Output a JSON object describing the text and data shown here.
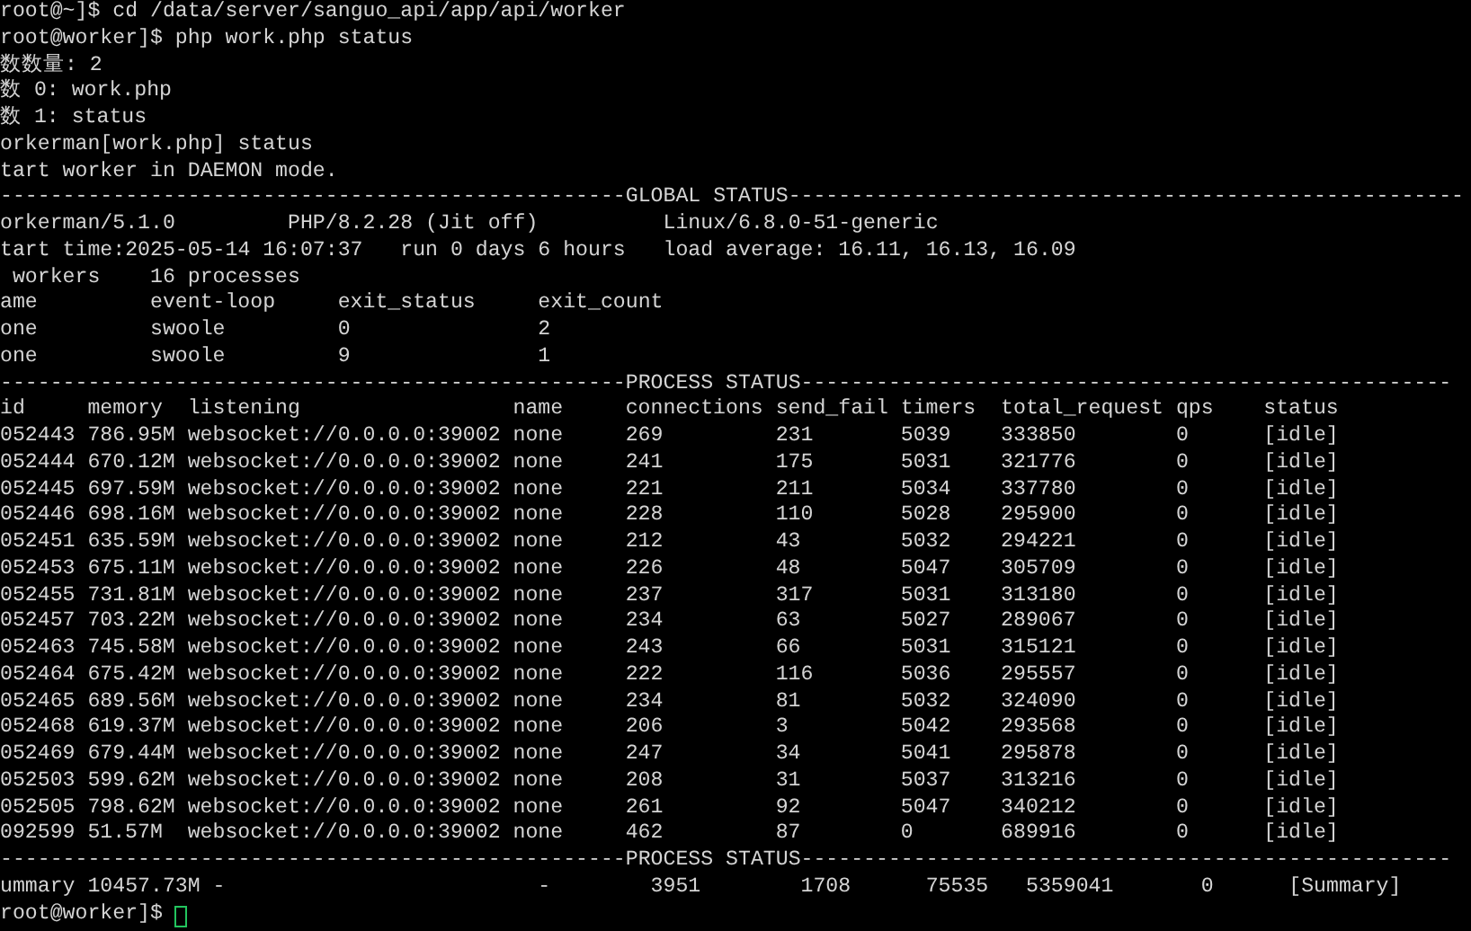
{
  "lines": [
    {
      "kind": "prompt",
      "prompt": "root@~]$",
      "command": "cd /data/server/sanguo_api/app/api/worker"
    },
    {
      "kind": "prompt",
      "prompt": "root@worker]$",
      "command": "php work.php status"
    },
    {
      "kind": "text",
      "text": "数数量: 2"
    },
    {
      "kind": "text",
      "text": "数 0: work.php"
    },
    {
      "kind": "text",
      "text": "数 1: status"
    },
    {
      "kind": "text",
      "text": "orkerman[work.php] status"
    },
    {
      "kind": "text",
      "text": "tart worker in DAEMON mode."
    },
    {
      "kind": "separator",
      "text": "--------------------------------------------------GLOBAL STATUS------------------------------------------------------"
    },
    {
      "kind": "text",
      "text": "orkerman/5.1.0         PHP/8.2.28 (Jit off)          Linux/6.8.0-51-generic"
    },
    {
      "kind": "text",
      "text": "tart time:2025-05-14 16:07:37   run 0 days 6 hours   load average: 16.11, 16.13, 16.09"
    },
    {
      "kind": "text",
      "text": " workers    16 processes"
    },
    {
      "kind": "table",
      "columns": [
        "ame",
        "event-loop",
        "exit_status",
        "exit_count"
      ],
      "rows": [
        [
          "one",
          "swoole",
          "0",
          "2"
        ],
        [
          "one",
          "swoole",
          "9",
          "1"
        ]
      ]
    },
    {
      "kind": "separator",
      "text": "--------------------------------------------------PROCESS STATUS----------------------------------------------------"
    },
    {
      "kind": "table",
      "columns": [
        "id",
        "memory",
        "listening",
        "name",
        "connections",
        "send_fail",
        "timers",
        "total_request",
        "qps",
        "status"
      ],
      "rows": [
        [
          "052443",
          "786.95M",
          "websocket://0.0.0.0:39002",
          "none",
          "269",
          "231",
          "5039",
          "333850",
          "0",
          "[idle]"
        ],
        [
          "052444",
          "670.12M",
          "websocket://0.0.0.0:39002",
          "none",
          "241",
          "175",
          "5031",
          "321776",
          "0",
          "[idle]"
        ],
        [
          "052445",
          "697.59M",
          "websocket://0.0.0.0:39002",
          "none",
          "221",
          "211",
          "5034",
          "337780",
          "0",
          "[idle]"
        ],
        [
          "052446",
          "698.16M",
          "websocket://0.0.0.0:39002",
          "none",
          "228",
          "110",
          "5028",
          "295900",
          "0",
          "[idle]"
        ],
        [
          "052451",
          "635.59M",
          "websocket://0.0.0.0:39002",
          "none",
          "212",
          "43",
          "5032",
          "294221",
          "0",
          "[idle]"
        ],
        [
          "052453",
          "675.11M",
          "websocket://0.0.0.0:39002",
          "none",
          "226",
          "48",
          "5047",
          "305709",
          "0",
          "[idle]"
        ],
        [
          "052455",
          "731.81M",
          "websocket://0.0.0.0:39002",
          "none",
          "237",
          "317",
          "5031",
          "313180",
          "0",
          "[idle]"
        ],
        [
          "052457",
          "703.22M",
          "websocket://0.0.0.0:39002",
          "none",
          "234",
          "63",
          "5027",
          "289067",
          "0",
          "[idle]"
        ],
        [
          "052463",
          "745.58M",
          "websocket://0.0.0.0:39002",
          "none",
          "243",
          "66",
          "5031",
          "315121",
          "0",
          "[idle]"
        ],
        [
          "052464",
          "675.42M",
          "websocket://0.0.0.0:39002",
          "none",
          "222",
          "116",
          "5036",
          "295557",
          "0",
          "[idle]"
        ],
        [
          "052465",
          "689.56M",
          "websocket://0.0.0.0:39002",
          "none",
          "234",
          "81",
          "5032",
          "324090",
          "0",
          "[idle]"
        ],
        [
          "052468",
          "619.37M",
          "websocket://0.0.0.0:39002",
          "none",
          "206",
          "3",
          "5042",
          "293568",
          "0",
          "[idle]"
        ],
        [
          "052469",
          "679.44M",
          "websocket://0.0.0.0:39002",
          "none",
          "247",
          "34",
          "5041",
          "295878",
          "0",
          "[idle]"
        ],
        [
          "052503",
          "599.62M",
          "websocket://0.0.0.0:39002",
          "none",
          "208",
          "31",
          "5037",
          "313216",
          "0",
          "[idle]"
        ],
        [
          "052505",
          "798.62M",
          "websocket://0.0.0.0:39002",
          "none",
          "261",
          "92",
          "5047",
          "340212",
          "0",
          "[idle]"
        ],
        [
          "092599",
          "51.57M",
          "websocket://0.0.0.0:39002",
          "none",
          "462",
          "87",
          "0",
          "689916",
          "0",
          "[idle]"
        ]
      ]
    },
    {
      "kind": "separator",
      "text": "--------------------------------------------------PROCESS STATUS----------------------------------------------------"
    },
    {
      "kind": "text",
      "text": "ummary 10457.73M -                         -        3951        1708      75535   5359041       0      [Summary]"
    },
    {
      "kind": "prompt",
      "prompt": "root@worker]$",
      "cursor": true
    }
  ]
}
